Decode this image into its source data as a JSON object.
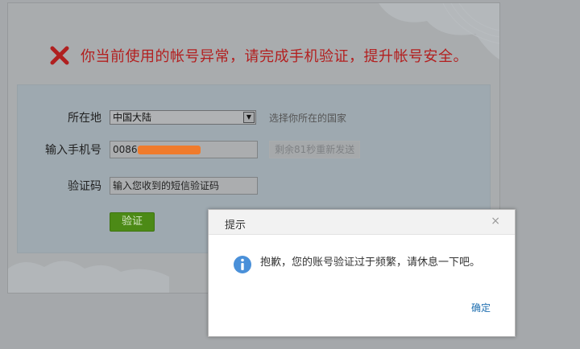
{
  "warning": {
    "message": "你当前使用的帐号异常，请完成手机验证，提升帐号安全。"
  },
  "form": {
    "location_label": "所在地",
    "location_value": "中国大陆",
    "location_hint": "选择你所在的国家",
    "phone_label": "输入手机号",
    "phone_prefix": "0086",
    "resend_label": "剩余81秒重新发送",
    "code_label": "验证码",
    "code_placeholder": "输入您收到的短信验证码",
    "verify_label": "验证"
  },
  "dialog": {
    "title": "提示",
    "close_glyph": "×",
    "message": "抱歉，您的账号验证过于频繁，请休息一下吧。",
    "ok_label": "确定"
  },
  "colors": {
    "warning_text": "#b31f1f",
    "verify_button": "#4c8a16",
    "info_icon": "#4a90d9",
    "link": "#1f6fb0",
    "redaction": "#f07b2c"
  },
  "icons": [
    "close-x-icon",
    "dropdown-arrow-icon",
    "info-icon",
    "dialog-close-icon"
  ]
}
